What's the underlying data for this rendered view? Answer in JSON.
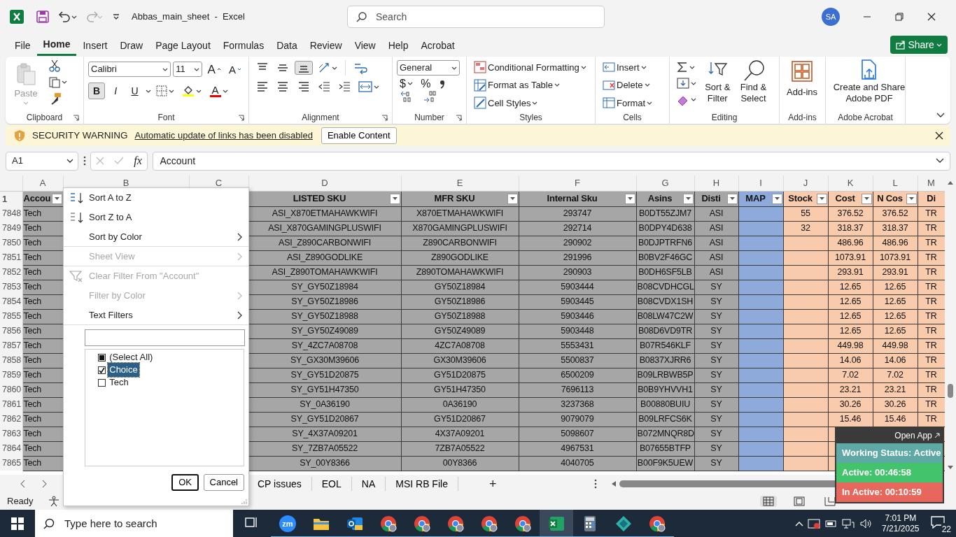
{
  "window": {
    "title": "Abbas_main_sheet  -  Excel",
    "search_placeholder": "Search",
    "avatar": "SA"
  },
  "ribbon_tabs": [
    {
      "label": "File",
      "selected": false
    },
    {
      "label": "Home",
      "selected": true
    },
    {
      "label": "Insert",
      "selected": false
    },
    {
      "label": "Draw",
      "selected": false
    },
    {
      "label": "Page Layout",
      "selected": false
    },
    {
      "label": "Formulas",
      "selected": false
    },
    {
      "label": "Data",
      "selected": false
    },
    {
      "label": "Review",
      "selected": false
    },
    {
      "label": "View",
      "selected": false
    },
    {
      "label": "Help",
      "selected": false
    },
    {
      "label": "Acrobat",
      "selected": false
    }
  ],
  "share": "Share",
  "clipboard": {
    "label": "Clipboard",
    "paste": "Paste"
  },
  "font": {
    "label": "Font",
    "name": "Calibri",
    "size": "11",
    "grow": "A",
    "shrink": "A",
    "color_letter": "A",
    "styles": [
      {
        "label": "B",
        "pressed": true
      },
      {
        "label": "I",
        "pressed": false
      },
      {
        "label": "U",
        "pressed": false
      }
    ]
  },
  "alignment": {
    "label": "Alignment",
    "vertical": [
      {
        "selected": false
      },
      {
        "selected": false
      },
      {
        "selected": true
      }
    ]
  },
  "number": {
    "label": "Number",
    "format": "General",
    "currency": "$",
    "percent": "%"
  },
  "styles": {
    "label": "Styles",
    "items": [
      "Conditional Formatting",
      "Format as Table",
      "Cell Styles"
    ]
  },
  "cells": {
    "label": "Cells",
    "items": [
      "Insert",
      "Delete",
      "Format"
    ]
  },
  "editing": {
    "label": "Editing",
    "sort_filter": "Sort & Filter",
    "find_select": "Find & Select"
  },
  "add_ins": {
    "label": "Add-ins",
    "button": "Add-ins"
  },
  "acrobat": {
    "label": "Adobe Acrobat",
    "button": "Create and Share Adobe PDF"
  },
  "security_bar": {
    "title": "SECURITY WARNING",
    "message": "Automatic update of links has been disabled",
    "button": "Enable Content"
  },
  "formula_bar": {
    "name_box": "A1",
    "fx": "fx",
    "value": "Account"
  },
  "header_row_number": "1",
  "columns": [
    {
      "letter": "A",
      "header": "Accou",
      "color": "#a6a6a6",
      "filter": true
    },
    {
      "letter": "B"
    },
    {
      "letter": "C"
    },
    {
      "letter": "D",
      "header": "LISTED SKU",
      "color": "#a6a6a6",
      "filter": true
    },
    {
      "letter": "E",
      "header": "MFR SKU",
      "color": "#a6a6a6",
      "filter": true
    },
    {
      "letter": "F",
      "header": "Internal Sku",
      "color": "#a6a6a6",
      "filter": true
    },
    {
      "letter": "G",
      "header": "Asins",
      "color": "#a6a6a6",
      "filter": true
    },
    {
      "letter": "H",
      "header": "Disti",
      "color": "#a6a6a6",
      "filter": true
    },
    {
      "letter": "I",
      "header": "MAP",
      "color": "#8eaadb",
      "filter": true
    },
    {
      "letter": "J",
      "header": "Stock",
      "color": "#f8cbad",
      "filter": true
    },
    {
      "letter": "K",
      "header": "Cost",
      "color": "#f8cbad",
      "filter": true
    },
    {
      "letter": "L",
      "header": "N Cos",
      "color": "#f8cbad",
      "filter": true
    },
    {
      "letter": "M",
      "header": "Di",
      "color": "#f8cbad",
      "filter": false
    }
  ],
  "rows": [
    {
      "number": "7848",
      "cells": {
        "A": "Tech",
        "D": "ASI_X870ETMAHAWKWIFI",
        "E": "X870ETMAHAWKWIFI",
        "F": "293747",
        "G": "B0DT55ZJM7",
        "H": "ASI",
        "J": "55",
        "K": "376.52",
        "L": "376.52",
        "M": "TR"
      }
    },
    {
      "number": "7849",
      "cells": {
        "A": "Tech",
        "D": "ASI_X870GAMINGPLUSWIFI",
        "E": "X870GAMINGPLUSWIFI",
        "F": "292714",
        "G": "B0DPY4D638",
        "H": "ASI",
        "J": "32",
        "K": "318.37",
        "L": "318.37",
        "M": "TR"
      }
    },
    {
      "number": "7850",
      "cells": {
        "A": "Tech",
        "D": "ASI_Z890CARBONWIFI",
        "E": "Z890CARBONWIFI",
        "F": "290902",
        "G": "B0DJPTRFN6",
        "H": "ASI",
        "K": "486.96",
        "L": "486.96",
        "M": "TR"
      }
    },
    {
      "number": "7851",
      "cells": {
        "A": "Tech",
        "D": "ASI_Z890GODLIKE",
        "E": "Z890GODLIKE",
        "F": "291996",
        "G": "B0BV2F46GC",
        "H": "ASI",
        "K": "1073.91",
        "L": "1073.91",
        "M": "TR"
      }
    },
    {
      "number": "7852",
      "cells": {
        "A": "Tech",
        "D": "ASI_Z890TOMAHAWKWIFI",
        "E": "Z890TOMAHAWKWIFI",
        "F": "290903",
        "G": "B0DH6SF5LB",
        "H": "ASI",
        "K": "293.91",
        "L": "293.91",
        "M": "TR"
      }
    },
    {
      "number": "7853",
      "cells": {
        "A": "Tech",
        "D": "SY_GY50Z18984",
        "E": "GY50Z18984",
        "F": "5903444",
        "G": "B08CVDHCGL",
        "H": "SY",
        "K": "12.65",
        "L": "12.65",
        "M": "TR"
      }
    },
    {
      "number": "7854",
      "cells": {
        "A": "Tech",
        "D": "SY_GY50Z18986",
        "E": "GY50Z18986",
        "F": "5903445",
        "G": "B08CVDX1SH",
        "H": "SY",
        "K": "12.65",
        "L": "12.65",
        "M": "TR"
      }
    },
    {
      "number": "7855",
      "cells": {
        "A": "Tech",
        "D": "SY_GY50Z18988",
        "E": "GY50Z18988",
        "F": "5903446",
        "G": "B08LW47C2W",
        "H": "SY",
        "K": "12.65",
        "L": "12.65",
        "M": "TR"
      }
    },
    {
      "number": "7856",
      "cells": {
        "A": "Tech",
        "D": "SY_GY50Z49089",
        "E": "GY50Z49089",
        "F": "5903448",
        "G": "B08D6VD9TR",
        "H": "SY",
        "K": "12.65",
        "L": "12.65",
        "M": "TR"
      }
    },
    {
      "number": "7857",
      "cells": {
        "A": "Tech",
        "D": "SY_4ZC7A08708",
        "E": "4ZC7A08708",
        "F": "5553431",
        "G": "B07R546KLF",
        "H": "SY",
        "K": "449.98",
        "L": "449.98",
        "M": "TR"
      }
    },
    {
      "number": "7858",
      "cells": {
        "A": "Tech",
        "D": "SY_GX30M39606",
        "E": "GX30M39606",
        "F": "5500837",
        "G": "B0837XJRR6",
        "H": "SY",
        "K": "14.06",
        "L": "14.06",
        "M": "TR"
      }
    },
    {
      "number": "7859",
      "cells": {
        "A": "Tech",
        "D": "SY_GY51D20875",
        "E": "GY51D20875",
        "F": "6500209",
        "G": "B09LRBWB5P",
        "H": "SY",
        "K": "7.02",
        "L": "7.02",
        "M": "TR"
      }
    },
    {
      "number": "7860",
      "cells": {
        "A": "Tech",
        "D": "SY_GY51H47350",
        "E": "GY51H47350",
        "F": "7696113",
        "G": "B0B9YHVVH1",
        "H": "SY",
        "K": "23.21",
        "L": "23.21",
        "M": "TR"
      }
    },
    {
      "number": "7861",
      "cells": {
        "A": "Tech",
        "D": "SY_0A36190",
        "E": "0A36190",
        "F": "3237368",
        "G": "B00880BUIU",
        "H": "SY",
        "K": "30.26",
        "L": "30.26",
        "M": "TR"
      }
    },
    {
      "number": "7862",
      "cells": {
        "A": "Tech",
        "D": "SY_GY51D20867",
        "E": "GY51D20867",
        "F": "9079079",
        "G": "B09LRFCS6K",
        "H": "SY",
        "K": "15.46",
        "L": "15.46",
        "M": "TR"
      }
    },
    {
      "number": "7863",
      "cells": {
        "A": "Tech",
        "D": "SY_4X37A09201",
        "E": "4X37A09201",
        "F": "5098607",
        "G": "B072MNQR8D",
        "H": "SY"
      }
    },
    {
      "number": "7864",
      "cells": {
        "A": "Tech",
        "D": "SY_7ZB7A05522",
        "E": "7ZB7A05522",
        "F": "4967531",
        "G": "B07655BTFP",
        "H": "SY"
      }
    },
    {
      "number": "7865",
      "cells": {
        "A": "Tech",
        "D": "SY_00Y8366",
        "E": "00Y8366",
        "F": "4040705",
        "G": "B00F9K5UEW",
        "H": "SY"
      }
    }
  ],
  "filter_menu": {
    "items": [
      {
        "label": "Sort A to Z",
        "kind": "sort_asc",
        "disabled": false,
        "submenu": false,
        "separator_after": false
      },
      {
        "label": "Sort Z to A",
        "kind": "sort_desc",
        "disabled": false,
        "submenu": false,
        "separator_after": false
      },
      {
        "label": "Sort by Color",
        "kind": "plain",
        "disabled": false,
        "submenu": true,
        "separator_after": true
      },
      {
        "label": "Sheet View",
        "kind": "plain",
        "disabled": true,
        "submenu": true,
        "separator_after": true
      },
      {
        "label": "Clear Filter From \"Account\"",
        "kind": "clear_filter",
        "disabled": true,
        "submenu": false,
        "separator_after": false
      },
      {
        "label": "Filter by Color",
        "kind": "plain",
        "disabled": true,
        "submenu": true,
        "separator_after": false
      },
      {
        "label": "Text Filters",
        "kind": "plain",
        "disabled": false,
        "submenu": true,
        "separator_after": true
      }
    ],
    "values": [
      {
        "label": "(Select All)",
        "checked": false,
        "partial": true,
        "selected": false
      },
      {
        "label": "Choice",
        "checked": true,
        "partial": false,
        "selected": true
      },
      {
        "label": "Tech",
        "checked": false,
        "partial": false,
        "selected": false
      }
    ],
    "buttons": [
      {
        "label": "OK",
        "default": true
      },
      {
        "label": "Cancel",
        "default": false
      }
    ]
  },
  "sheet_tabs": [
    "CP issues",
    "EOL",
    "NA",
    "MSI RB File"
  ],
  "add_sheet": "+",
  "status": "Ready",
  "tracker": {
    "open_app": "Open App",
    "rows": [
      {
        "label": "Working Status: Active",
        "color": "#5ea9a3"
      },
      {
        "label": "Active: 00:46:58",
        "color": "#43c46c"
      },
      {
        "label": "In Active: 00:10:59",
        "color": "#e8675c"
      }
    ]
  },
  "taskbar": {
    "search_placeholder": "Type here to search",
    "apps": [
      {
        "kind": "task_view",
        "running": false,
        "selected": false
      },
      {
        "kind": "zoom",
        "label": "zm",
        "running": true,
        "selected": false
      },
      {
        "kind": "explorer",
        "running": true,
        "selected": false
      },
      {
        "kind": "outlook",
        "running": true,
        "selected": false
      },
      {
        "kind": "chrome",
        "running": true,
        "selected": false
      },
      {
        "kind": "chrome",
        "running": true,
        "selected": false
      },
      {
        "kind": "chrome",
        "running": true,
        "selected": false
      },
      {
        "kind": "chrome",
        "running": true,
        "selected": false
      },
      {
        "kind": "chrome",
        "running": true,
        "selected": false
      },
      {
        "kind": "excel",
        "running": true,
        "selected": true
      },
      {
        "kind": "calculator",
        "running": true,
        "selected": false
      },
      {
        "kind": "app",
        "running": true,
        "selected": false
      },
      {
        "kind": "chrome",
        "running": true,
        "selected": false
      }
    ],
    "time": "7:01 PM",
    "date": "7/21/2025",
    "notifications": "22"
  }
}
